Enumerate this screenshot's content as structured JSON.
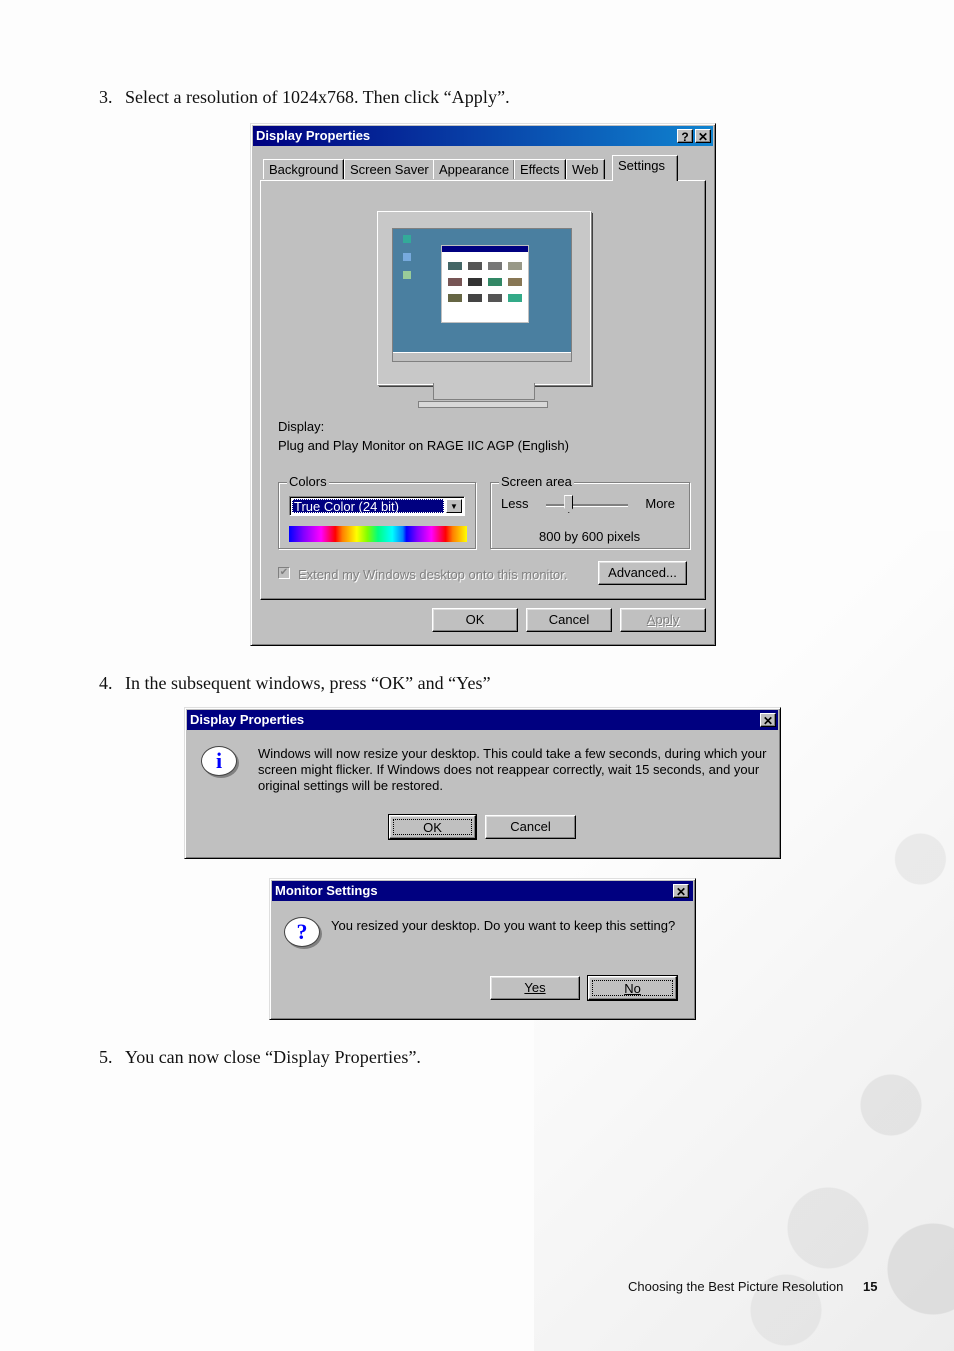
{
  "steps": [
    {
      "num": "3.",
      "text": "Select a resolution of 1024x768. Then click “",
      "em": "Apply",
      "tail": "”."
    },
    {
      "num": "4.",
      "text": "In the subsequent windows, press “",
      "em": "OK",
      "mid": "” and “",
      "em2": "Yes",
      "tail": "”"
    },
    {
      "num": "5.",
      "text": "You can now close “",
      "em": "Display Properties",
      "tail": "”."
    }
  ],
  "display_properties": {
    "title": "Display Properties",
    "help_glyph": "?",
    "close_glyph": "✕",
    "tabs": [
      "Background",
      "Screen Saver",
      "Appearance",
      "Effects",
      "Web",
      "Settings"
    ],
    "active_tab": "Settings",
    "display_label": "Display:",
    "display_value": "Plug and Play Monitor on RAGE IIC AGP (English)",
    "colors": {
      "legend": "Colors",
      "selected": "True Color (24 bit)",
      "dropdown_glyph": "▼"
    },
    "screen_area": {
      "legend": "Screen area",
      "less": "Less",
      "more": "More",
      "value_text": "800 by 600 pixels",
      "slider_fraction": 0.25
    },
    "extend_checkbox": {
      "label": "Extend my Windows desktop onto this monitor.",
      "checked": true,
      "disabled": true
    },
    "advanced_button": "Advanced...",
    "ok_button": "OK",
    "cancel_button": "Cancel",
    "apply_button": "Apply"
  },
  "resize_dialog": {
    "title": "Display Properties",
    "close_glyph": "✕",
    "icon_glyph": "i",
    "message": "Windows will now resize your desktop. This could take a few seconds, during which your screen might flicker.  If Windows does not reappear correctly, wait 15 seconds, and your original settings will be restored.",
    "ok_button": "OK",
    "cancel_button": "Cancel"
  },
  "monitor_dialog": {
    "title": "Monitor Settings",
    "close_glyph": "✕",
    "icon_glyph": "?",
    "message": "You resized your desktop.  Do you want to keep this setting?",
    "yes_button": "Yes",
    "no_button": "No"
  },
  "footer": {
    "section": "Choosing the Best Picture Resolution",
    "page": "15"
  }
}
